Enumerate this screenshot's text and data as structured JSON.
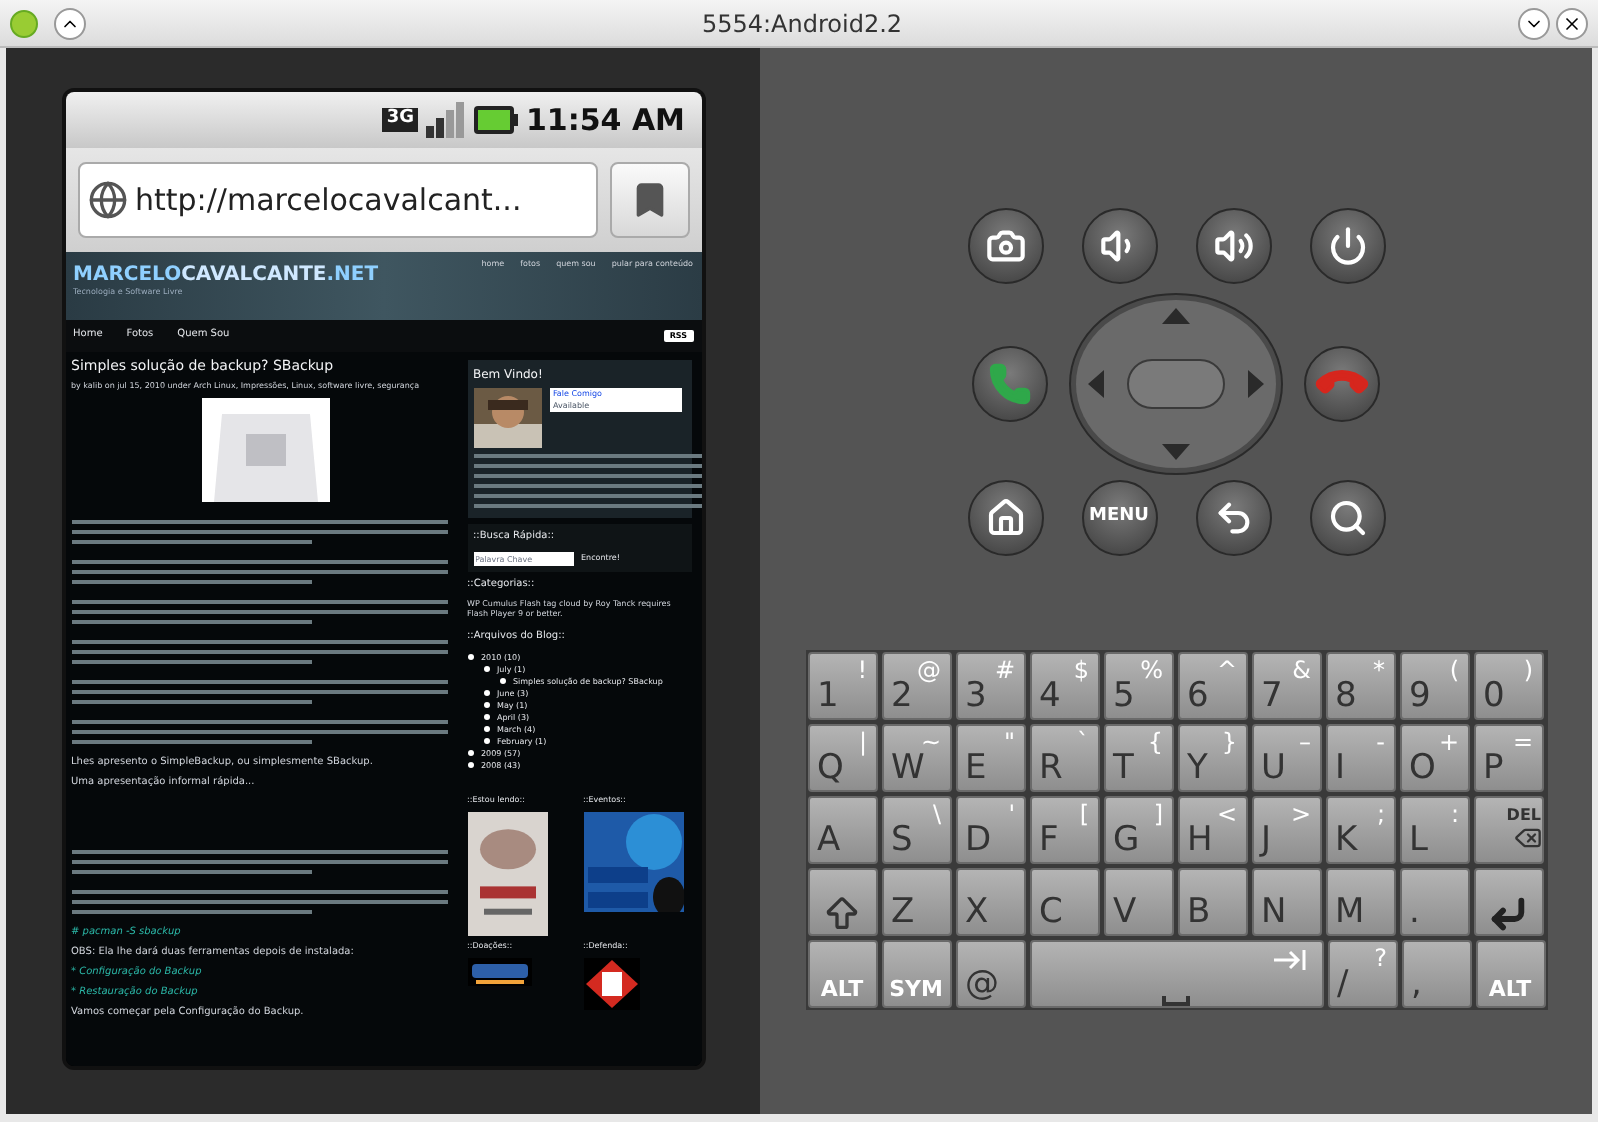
{
  "window": {
    "title": "5554:Android2.2"
  },
  "status_bar": {
    "network": "3G",
    "time": "11:54 AM"
  },
  "browser": {
    "url": "http://marcelocavalcant..."
  },
  "site": {
    "logo_a": "MARCELO",
    "logo_b": "CAVALCANTE",
    "logo_c": ".NET",
    "tagline": "Tecnologia e Software Livre",
    "top_links": [
      "home",
      "fotos",
      "quem sou",
      "pular para conteúdo"
    ],
    "nav": [
      "Home",
      "Fotos",
      "Quem Sou"
    ],
    "rss": "RSS"
  },
  "post": {
    "title": "Simples solução de backup? SBackup",
    "meta": "by kalib on jul 15, 2010 under Arch Linux, Impressões, Linux, software livre, segurança",
    "paragraphs": [
      {
        "kind": "lines"
      },
      {
        "kind": "lines"
      },
      {
        "kind": "lines"
      },
      {
        "kind": "lines"
      },
      {
        "kind": "lines"
      },
      {
        "kind": "lines"
      },
      {
        "kind": "text",
        "text": "Lhes apresento o SimpleBackup, ou simplesmente SBackup."
      },
      {
        "kind": "text",
        "text": "Uma apresentação informal rápida..."
      },
      {
        "kind": "gap"
      },
      {
        "kind": "lines"
      },
      {
        "kind": "lines"
      },
      {
        "kind": "code",
        "text": "# pacman -S sbackup"
      },
      {
        "kind": "text",
        "text": "OBS: Ela lhe dará duas ferramentas depois de instalada:"
      },
      {
        "kind": "code",
        "text": "* Configuração do Backup"
      },
      {
        "kind": "code",
        "text": "* Restauração do Backup"
      },
      {
        "kind": "text",
        "text": "Vamos começar pela Configuração do Backup."
      }
    ]
  },
  "sidebar": {
    "welcome": "Bem Vindo!",
    "chat_title": "Fale Comigo",
    "chat_status": "Available",
    "search_title": "::Busca Rápida::",
    "search_placeholder": "Palavra Chave",
    "search_button": "Encontre!",
    "categories_title": "::Categorias::",
    "categories_text": "WP Cumulus Flash tag cloud by Roy Tanck requires Flash Player 9 or better.",
    "archive_title": "::Arquivos do Blog::",
    "archive": [
      {
        "label": "2010 (10)",
        "children": [
          {
            "label": "July (1)",
            "children": [
              {
                "label": "Simples solução de backup? SBackup"
              }
            ]
          },
          {
            "label": "June (3)"
          },
          {
            "label": "May (1)"
          },
          {
            "label": "April (3)"
          },
          {
            "label": "March (4)"
          },
          {
            "label": "February (1)"
          }
        ]
      },
      {
        "label": "2009 (57)"
      },
      {
        "label": "2008 (43)"
      }
    ],
    "widgets": [
      {
        "title": "::Estou lendo::"
      },
      {
        "title": "::Eventos::"
      },
      {
        "title": "::Doações::"
      },
      {
        "title": "::Defenda::"
      }
    ]
  },
  "controls": [
    {
      "kind": "camera"
    },
    {
      "kind": "volume-down"
    },
    {
      "kind": "volume-up"
    },
    {
      "kind": "power"
    },
    {
      "kind": "call"
    },
    {
      "kind": "dpad"
    },
    {
      "kind": "hangup"
    },
    {
      "kind": "home"
    },
    {
      "kind": "menu",
      "label": "MENU"
    },
    {
      "kind": "back"
    },
    {
      "kind": "search"
    }
  ],
  "keyboard": [
    [
      {
        "kind": "char",
        "main": "1",
        "alt": "!"
      },
      {
        "kind": "char",
        "main": "2",
        "alt": "@"
      },
      {
        "kind": "char",
        "main": "3",
        "alt": "#"
      },
      {
        "kind": "char",
        "main": "4",
        "alt": "$"
      },
      {
        "kind": "char",
        "main": "5",
        "alt": "%"
      },
      {
        "kind": "char",
        "main": "6",
        "alt": "^"
      },
      {
        "kind": "char",
        "main": "7",
        "alt": "&"
      },
      {
        "kind": "char",
        "main": "8",
        "alt": "*"
      },
      {
        "kind": "char",
        "main": "9",
        "alt": "("
      },
      {
        "kind": "char",
        "main": "0",
        "alt": ")"
      }
    ],
    [
      {
        "kind": "char",
        "main": "Q",
        "alt": "|"
      },
      {
        "kind": "char",
        "main": "W",
        "alt": "~"
      },
      {
        "kind": "char",
        "main": "E",
        "alt": "\""
      },
      {
        "kind": "char",
        "main": "R",
        "alt": "`"
      },
      {
        "kind": "char",
        "main": "T",
        "alt": "{"
      },
      {
        "kind": "char",
        "main": "Y",
        "alt": "}"
      },
      {
        "kind": "char",
        "main": "U",
        "alt": "–"
      },
      {
        "kind": "char",
        "main": "I",
        "alt": "-"
      },
      {
        "kind": "char",
        "main": "O",
        "alt": "+"
      },
      {
        "kind": "char",
        "main": "P",
        "alt": "="
      }
    ],
    [
      {
        "kind": "char",
        "main": "A"
      },
      {
        "kind": "char",
        "main": "S",
        "alt": "\\"
      },
      {
        "kind": "char",
        "main": "D",
        "alt": "'"
      },
      {
        "kind": "char",
        "main": "F",
        "alt": "["
      },
      {
        "kind": "char",
        "main": "G",
        "alt": "]"
      },
      {
        "kind": "char",
        "main": "H",
        "alt": "<"
      },
      {
        "kind": "char",
        "main": "J",
        "alt": ">"
      },
      {
        "kind": "char",
        "main": "K",
        "alt": ";"
      },
      {
        "kind": "char",
        "main": "L",
        "alt": ":"
      },
      {
        "kind": "delete",
        "main": "DEL"
      }
    ],
    [
      {
        "kind": "shift"
      },
      {
        "kind": "char",
        "main": "Z"
      },
      {
        "kind": "char",
        "main": "X"
      },
      {
        "kind": "char",
        "main": "C"
      },
      {
        "kind": "char",
        "main": "V"
      },
      {
        "kind": "char",
        "main": "B"
      },
      {
        "kind": "char",
        "main": "N"
      },
      {
        "kind": "char",
        "main": "M"
      },
      {
        "kind": "char",
        "main": "."
      },
      {
        "kind": "enter"
      }
    ],
    [
      {
        "kind": "bold",
        "main": "ALT"
      },
      {
        "kind": "bold",
        "main": "SYM"
      },
      {
        "kind": "char",
        "main": "@"
      },
      {
        "kind": "space"
      },
      {
        "kind": "char",
        "main": "/",
        "alt": "?"
      },
      {
        "kind": "char",
        "main": ","
      },
      {
        "kind": "bold",
        "main": "ALT"
      }
    ]
  ]
}
